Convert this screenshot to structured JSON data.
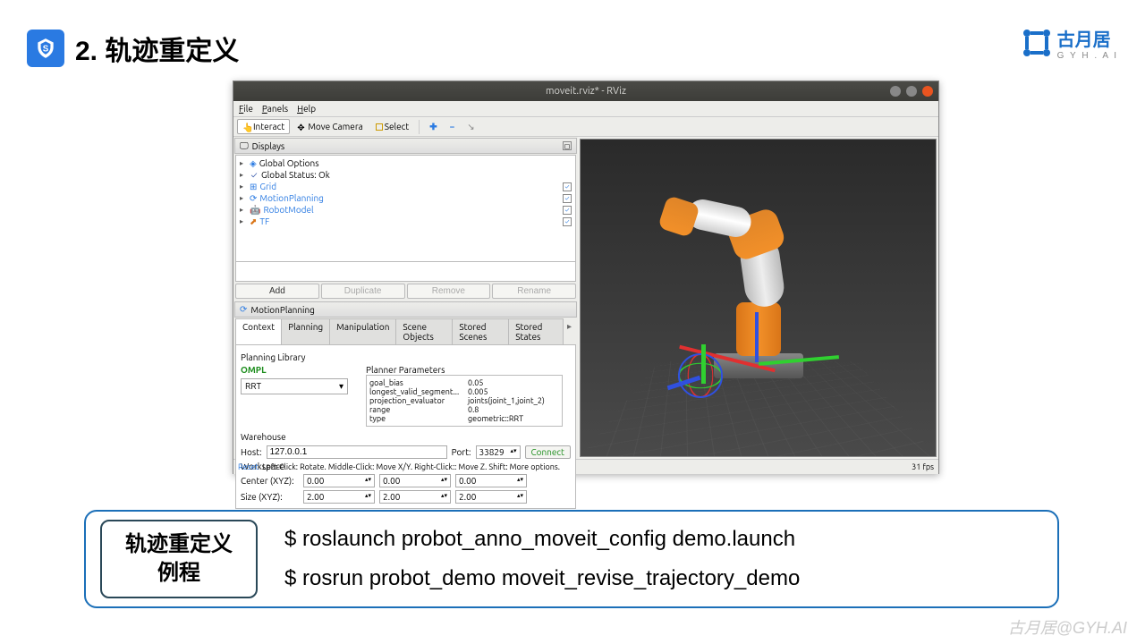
{
  "slide": {
    "section_number": "2.",
    "title": "轨迹重定义"
  },
  "brand": {
    "name": "古月居",
    "sub": "G Y H . A I"
  },
  "watermark": "古月居@GYH.AI",
  "rviz": {
    "title": "moveit.rviz* - RViz",
    "menu": {
      "file": "File",
      "panels": "Panels",
      "help": "Help"
    },
    "toolbar": {
      "interact": "Interact",
      "move_camera": "Move Camera",
      "select": "Select"
    },
    "displays": {
      "header": "Displays",
      "items": [
        {
          "label": "Global Options",
          "link": false
        },
        {
          "label": "Global Status: Ok",
          "link": false,
          "check": true
        },
        {
          "label": "Grid",
          "link": true,
          "cb": true
        },
        {
          "label": "MotionPlanning",
          "link": true,
          "cb": true
        },
        {
          "label": "RobotModel",
          "link": true,
          "cb": true
        },
        {
          "label": "TF",
          "link": true,
          "cb": true
        }
      ],
      "buttons": {
        "add": "Add",
        "duplicate": "Duplicate",
        "remove": "Remove",
        "rename": "Rename"
      }
    },
    "motion": {
      "header": "MotionPlanning",
      "tabs": [
        "Context",
        "Planning",
        "Manipulation",
        "Scene Objects",
        "Stored Scenes",
        "Stored States"
      ],
      "planning_library": "Planning Library",
      "ompl": "OMPL",
      "planner_params": "Planner Parameters",
      "planner_select": "RRT",
      "params": [
        {
          "k": "goal_bias",
          "v": "0.05"
        },
        {
          "k": "longest_valid_segment...",
          "v": "0.005"
        },
        {
          "k": "projection_evaluator",
          "v": "joints(joint_1,joint_2)"
        },
        {
          "k": "range",
          "v": "0.8"
        },
        {
          "k": "type",
          "v": "geometric::RRT"
        }
      ],
      "warehouse": "Warehouse",
      "host_label": "Host:",
      "host": "127.0.0.1",
      "port_label": "Port:",
      "port": "33829",
      "connect": "Connect",
      "workspace": "Workspace",
      "center_label": "Center (XYZ):",
      "center": [
        "0.00",
        "0.00",
        "0.00"
      ],
      "size_label": "Size (XYZ):",
      "size": [
        "2.00",
        "2.00",
        "2.00"
      ]
    },
    "status": {
      "reset": "Reset",
      "hint": "Left-Click: Rotate. Middle-Click: Move X/Y. Right-Click:: Move Z. Shift: More options.",
      "fps": "31 fps"
    }
  },
  "commands": {
    "label_line1": "轨迹重定义",
    "label_line2": "例程",
    "cmd1": "$ roslaunch probot_anno_moveit_config demo.launch",
    "cmd2": "$ rosrun probot_demo moveit_revise_trajectory_demo"
  }
}
